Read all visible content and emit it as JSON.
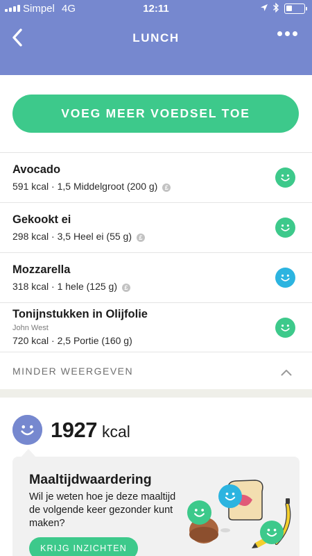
{
  "status_bar": {
    "carrier": "Simpel",
    "network": "4G",
    "time": "12:11"
  },
  "nav": {
    "title": "LUNCH",
    "back_icon": "chevron-left-icon",
    "more_icon": "more-dots-icon"
  },
  "add_button": {
    "label": "VOEG MEER VOEDSEL TOE"
  },
  "foods": [
    {
      "name": "Avocado",
      "brand": "",
      "detail": "591 kcal · 1,5 Middelgroot (200 g)",
      "verified": true,
      "rating_color": "#3dc98b"
    },
    {
      "name": "Gekookt ei",
      "brand": "",
      "detail": "298 kcal · 3,5 Heel ei (55 g)",
      "verified": true,
      "rating_color": "#3dc98b"
    },
    {
      "name": "Mozzarella",
      "brand": "",
      "detail": "318 kcal · 1 hele (125 g)",
      "verified": true,
      "rating_color": "#2cb4e0"
    },
    {
      "name": "Tonijnstukken in Olijfolie",
      "brand": "John West",
      "detail": "720 kcal · 2,5 Portie (160 g)",
      "verified": false,
      "rating_color": "#3dc98b"
    }
  ],
  "show_less": {
    "label": "MINDER WEERGEVEN",
    "icon": "chevron-up-icon"
  },
  "summary": {
    "kcal": "1927",
    "unit": "kcal",
    "rating_color": "#7688cf"
  },
  "insight_card": {
    "title": "Maaltijdwaardering",
    "body": "Wil je weten hoe je deze maaltijd de volgende keer gezonder kunt maken?",
    "button_label": "KRIJG INZICHTEN"
  },
  "colors": {
    "header": "#7688cf",
    "accent_green": "#3dc98b",
    "accent_blue": "#2cb4e0"
  }
}
